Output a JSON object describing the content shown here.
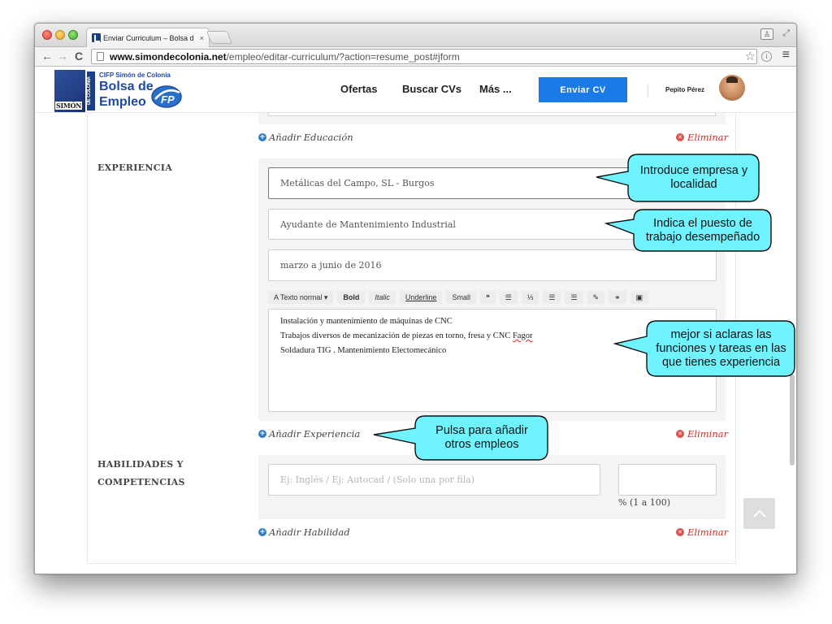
{
  "browser": {
    "tab_title": "Enviar Curriculum – Bolsa d",
    "tab_close": "×",
    "url_host": "www.simondecolonia.net",
    "url_path": "/empleo/editar-curriculum/?action=resume_post#jform",
    "back": "←",
    "forward": "→",
    "reload": "C",
    "star": "☆",
    "menu": "≡"
  },
  "site": {
    "logo_org": "CIFP Simón de Colonia",
    "logo_line1": "Bolsa de",
    "logo_line2": "Empleo",
    "logo_box_text": "SIMÓN",
    "logo_vertical": "DE COLONIA",
    "nav": {
      "ofertas": "Ofertas",
      "buscar_cvs": "Buscar CVs",
      "mas": "Más ..."
    },
    "cta": "Enviar CV",
    "user_name": "Pepito Pérez"
  },
  "form": {
    "add_education": "Añadir Educación",
    "delete": "Eliminar",
    "experience_label": "EXPERIENCIA",
    "employer": "Metálicas del Campo, SL - Burgos",
    "job_title": "Ayudante de Mantenimiento Industrial",
    "dates": "marzo a junio de 2016",
    "toolbar": {
      "text_style": "A Texto normal ▾",
      "bold": "Bold",
      "italic": "Italic",
      "underline": "Underline",
      "small": "Small",
      "quote": "❝",
      "list_ul": "☰",
      "list_ol": "⅓",
      "indent_left": "☰",
      "indent_right": "☰",
      "pen": "✎",
      "link": "⚭",
      "image": "▣"
    },
    "description_lines": [
      "Instalación y mantenimiento de máquinas de CNC",
      "Trabajos diversos de mecanización de piezas en torno, fresa y CNC ",
      "Soldadura TIG . Mantenimiento Electomecánico"
    ],
    "description_spell_word": "Fagor",
    "add_experience": "Añadir Experiencia",
    "skills_label_line1": "HABILIDADES Y",
    "skills_label_line2": "COMPETENCIAS",
    "skill_placeholder": "Ej: Inglés  / Ej: Autocad / (Solo una por fila)",
    "percent_value": "",
    "percent_label": "% (1 a 100)",
    "add_skill": "Añadir Habilidad"
  },
  "callouts": {
    "company": [
      "Introduce empresa y",
      "localidad"
    ],
    "job": [
      "Indica el puesto de",
      "trabajo desempeñado"
    ],
    "tasks": [
      "mejor si aclaras las",
      "funciones y tareas en las",
      "que tienes experiencia"
    ],
    "add_jobs": [
      "Pulsa para añadir",
      "otros empleos"
    ]
  },
  "colors": {
    "callout_fill": "#6ff3ff",
    "cta_blue": "#1a7be8",
    "delete_red": "#d9534f",
    "add_blue": "#2f7cc6"
  }
}
